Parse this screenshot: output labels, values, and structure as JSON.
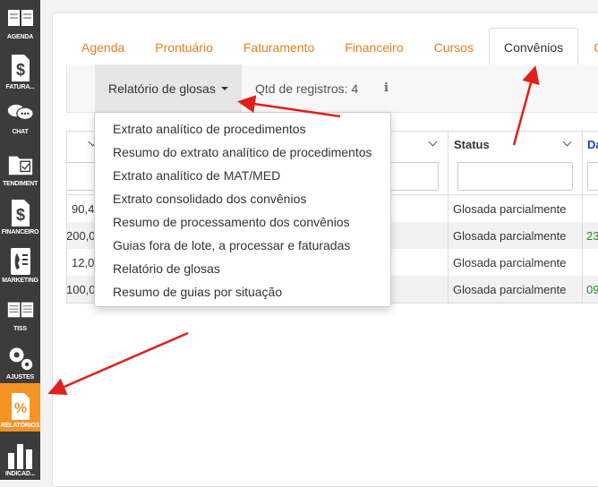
{
  "sidebar": {
    "items": [
      {
        "label": "AGENDA",
        "icon": "calendar-icon"
      },
      {
        "label": "FATURA...",
        "icon": "dollar-icon"
      },
      {
        "label": "CHAT",
        "icon": "chat-bubbles-icon"
      },
      {
        "label": "TENDIMENT",
        "icon": "attendance-icon"
      },
      {
        "label": "FINANCEIRO",
        "icon": "dollar-icon"
      },
      {
        "label": "MARKETING",
        "icon": "phone-icon"
      },
      {
        "label": "TISS",
        "icon": "book-icon"
      },
      {
        "label": "AJUSTES",
        "icon": "gears-icon"
      },
      {
        "label": "RELATÓRIOS",
        "icon": "percent-icon",
        "active": true
      },
      {
        "label": "INDICAD...",
        "icon": "bar-chart-icon"
      }
    ],
    "active_color": "#f39425"
  },
  "tabs": [
    {
      "label": "Agenda"
    },
    {
      "label": "Prontuário"
    },
    {
      "label": "Faturamento"
    },
    {
      "label": "Financeiro"
    },
    {
      "label": "Cursos"
    },
    {
      "label": "Convênios",
      "active": true
    },
    {
      "label": "C"
    }
  ],
  "toolbar": {
    "dropdown_label": "Relatório de glosas",
    "qtd_label": "Qtd de registros: 4",
    "info_icon": "i"
  },
  "table": {
    "headers": {
      "status": "Status",
      "next": "Da"
    },
    "rows": [
      {
        "value": "90,4",
        "status": "Glosada parcialmente",
        "extra": ""
      },
      {
        "value": "200,0",
        "status": "Glosada parcialmente",
        "extra": "23"
      },
      {
        "value": "12,0",
        "status": "Glosada parcialmente",
        "extra": ""
      },
      {
        "value": "100,0",
        "status": "Glosada parcialmente",
        "extra": "09"
      }
    ],
    "extra_color": "#2a8a2a",
    "header_next_color": "#1a3fbf"
  },
  "menu": {
    "items": [
      "Extrato analítico de procedimentos",
      "Resumo do extrato analítico de procedimentos",
      "Extrato analítico de MAT/MED",
      "Extrato consolidado dos convênios",
      "Resumo de processamento dos convênios",
      "Guias fora de lote, a processar e faturadas",
      "Relatório de glosas",
      "Resumo de guias por situação"
    ]
  },
  "colors": {
    "accent": "#e67e22",
    "arrow": "#e0201b"
  }
}
